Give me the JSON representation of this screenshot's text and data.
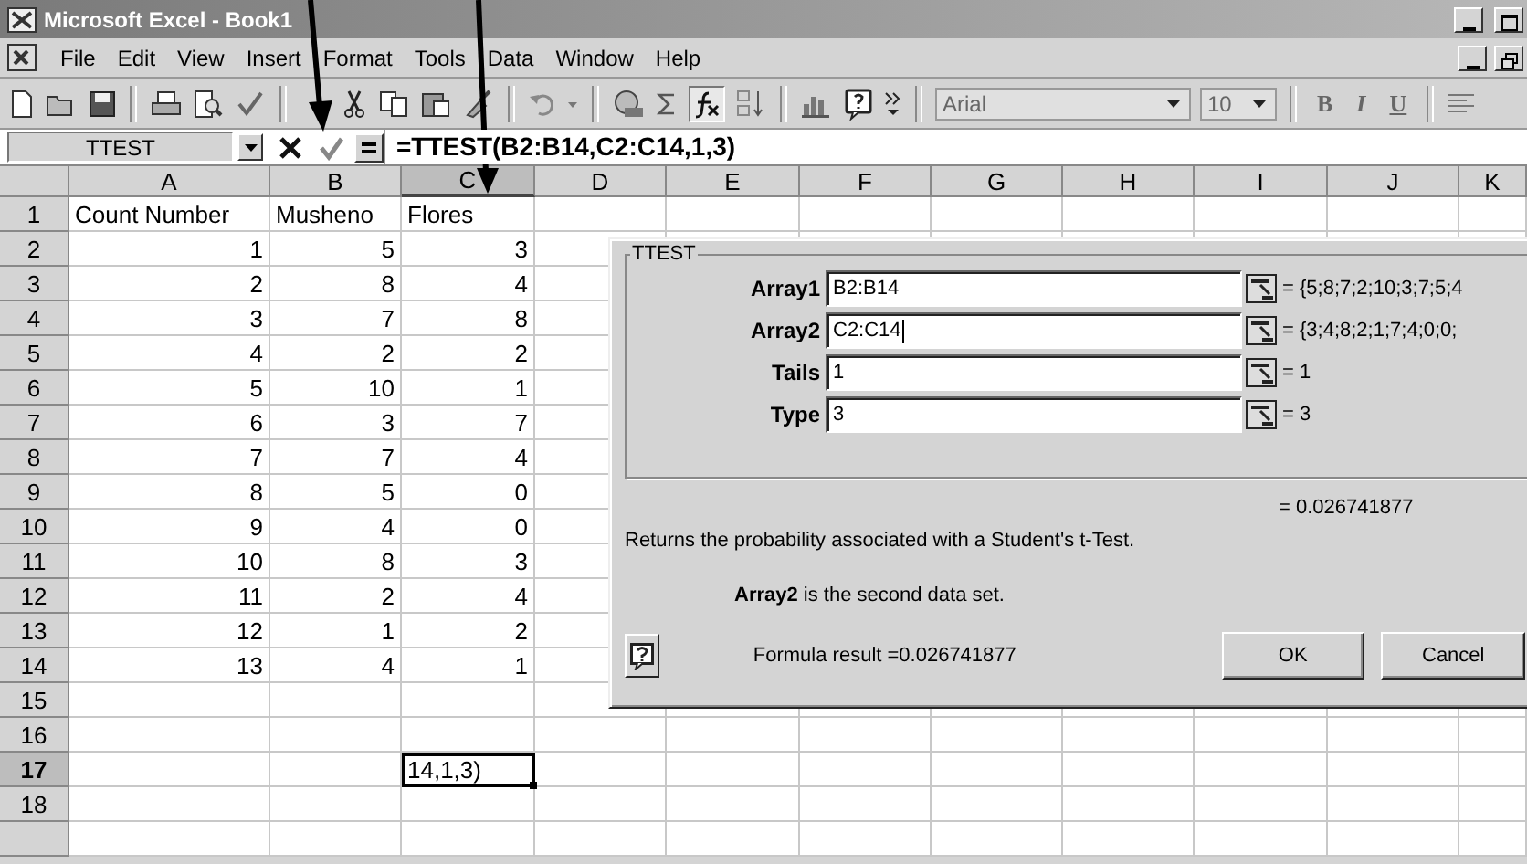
{
  "window": {
    "title": "Microsoft Excel - Book1"
  },
  "menu": [
    "File",
    "Edit",
    "View",
    "Insert",
    "Format",
    "Tools",
    "Data",
    "Window",
    "Help"
  ],
  "toolbar": {
    "font": "Arial",
    "size": "10",
    "format_buttons": [
      {
        "label": "B",
        "kind": "bold"
      },
      {
        "label": "I",
        "kind": "italic"
      },
      {
        "label": "U",
        "kind": "underline"
      }
    ]
  },
  "formula_bar": {
    "name_box": "TTEST",
    "formula": "=TTEST(B2:B14,C2:C14,1,3)"
  },
  "sheet": {
    "columns": [
      {
        "label": "A",
        "selected": false
      },
      {
        "label": "B",
        "selected": false
      },
      {
        "label": "C",
        "selected": true
      },
      {
        "label": "D",
        "selected": false
      },
      {
        "label": "E",
        "selected": false
      },
      {
        "label": "F",
        "selected": false
      },
      {
        "label": "G",
        "selected": false
      },
      {
        "label": "H",
        "selected": false
      },
      {
        "label": "I",
        "selected": false
      },
      {
        "label": "J",
        "selected": false
      },
      {
        "label": "K",
        "selected": false
      }
    ],
    "rows": [
      {
        "number": "1",
        "selected": false,
        "cells": [
          {
            "text": "Count Number",
            "kind": "text"
          },
          {
            "text": "Musheno",
            "kind": "text"
          },
          {
            "text": "Flores",
            "kind": "text"
          }
        ]
      },
      {
        "number": "2",
        "selected": false,
        "cells": [
          {
            "text": "1",
            "kind": "number"
          },
          {
            "text": "5",
            "kind": "number"
          },
          {
            "text": "3",
            "kind": "number"
          }
        ]
      },
      {
        "number": "3",
        "selected": false,
        "cells": [
          {
            "text": "2",
            "kind": "number"
          },
          {
            "text": "8",
            "kind": "number"
          },
          {
            "text": "4",
            "kind": "number"
          }
        ]
      },
      {
        "number": "4",
        "selected": false,
        "cells": [
          {
            "text": "3",
            "kind": "number"
          },
          {
            "text": "7",
            "kind": "number"
          },
          {
            "text": "8",
            "kind": "number"
          }
        ]
      },
      {
        "number": "5",
        "selected": false,
        "cells": [
          {
            "text": "4",
            "kind": "number"
          },
          {
            "text": "2",
            "kind": "number"
          },
          {
            "text": "2",
            "kind": "number"
          }
        ]
      },
      {
        "number": "6",
        "selected": false,
        "cells": [
          {
            "text": "5",
            "kind": "number"
          },
          {
            "text": "10",
            "kind": "number"
          },
          {
            "text": "1",
            "kind": "number"
          }
        ]
      },
      {
        "number": "7",
        "selected": false,
        "cells": [
          {
            "text": "6",
            "kind": "number"
          },
          {
            "text": "3",
            "kind": "number"
          },
          {
            "text": "7",
            "kind": "number"
          }
        ]
      },
      {
        "number": "8",
        "selected": false,
        "cells": [
          {
            "text": "7",
            "kind": "number"
          },
          {
            "text": "7",
            "kind": "number"
          },
          {
            "text": "4",
            "kind": "number"
          }
        ]
      },
      {
        "number": "9",
        "selected": false,
        "cells": [
          {
            "text": "8",
            "kind": "number"
          },
          {
            "text": "5",
            "kind": "number"
          },
          {
            "text": "0",
            "kind": "number"
          }
        ]
      },
      {
        "number": "10",
        "selected": false,
        "cells": [
          {
            "text": "9",
            "kind": "number"
          },
          {
            "text": "4",
            "kind": "number"
          },
          {
            "text": "0",
            "kind": "number"
          }
        ]
      },
      {
        "number": "11",
        "selected": false,
        "cells": [
          {
            "text": "10",
            "kind": "number"
          },
          {
            "text": "8",
            "kind": "number"
          },
          {
            "text": "3",
            "kind": "number"
          }
        ]
      },
      {
        "number": "12",
        "selected": false,
        "cells": [
          {
            "text": "11",
            "kind": "number"
          },
          {
            "text": "2",
            "kind": "number"
          },
          {
            "text": "4",
            "kind": "number"
          }
        ]
      },
      {
        "number": "13",
        "selected": false,
        "cells": [
          {
            "text": "12",
            "kind": "number"
          },
          {
            "text": "1",
            "kind": "number"
          },
          {
            "text": "2",
            "kind": "number"
          }
        ]
      },
      {
        "number": "14",
        "selected": false,
        "cells": [
          {
            "text": "13",
            "kind": "number"
          },
          {
            "text": "4",
            "kind": "number"
          },
          {
            "text": "1",
            "kind": "number"
          }
        ]
      },
      {
        "number": "15",
        "selected": false,
        "cells": []
      },
      {
        "number": "16",
        "selected": false,
        "cells": []
      },
      {
        "number": "17",
        "selected": true,
        "cells": [
          {
            "text": "",
            "kind": "empty"
          },
          {
            "text": "",
            "kind": "empty"
          },
          {
            "text": "14,1,3)",
            "kind": "active"
          }
        ]
      },
      {
        "number": "18",
        "selected": false,
        "cells": []
      }
    ]
  },
  "dialog": {
    "group_title": "TTEST",
    "arguments": [
      {
        "label": "Array1",
        "value": "B2:B14",
        "result": "= {5;8;7;2;10;3;7;5;4"
      },
      {
        "label": "Array2",
        "value": "C2:C14",
        "result": "= {3;4;8;2;1;7;4;0;0;"
      },
      {
        "label": "Tails",
        "value": "1",
        "result": "= 1"
      },
      {
        "label": "Type",
        "value": "3",
        "result": "= 3"
      }
    ],
    "result": "= 0.026741877",
    "description": "Returns the probability associated with a Student's t-Test.",
    "argument_help": "**Array2** is the second data set.",
    "formula_result": "Formula result =0.026741877",
    "buttons": [
      "OK",
      "Cancel"
    ]
  }
}
